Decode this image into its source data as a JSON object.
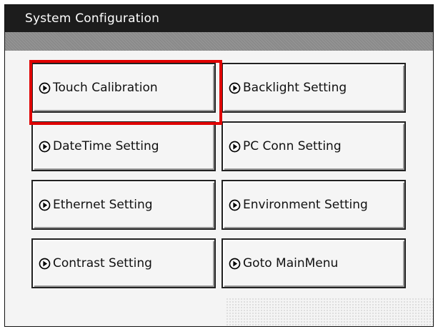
{
  "window": {
    "title": "System Configuration"
  },
  "menu": {
    "buttons": [
      {
        "label": "Touch Calibration",
        "icon": "circle-arrow-right-icon"
      },
      {
        "label": "Backlight Setting",
        "icon": "circle-arrow-right-icon"
      },
      {
        "label": "DateTime Setting",
        "icon": "circle-arrow-right-icon"
      },
      {
        "label": "PC Conn Setting",
        "icon": "circle-arrow-right-icon"
      },
      {
        "label": "Ethernet Setting",
        "icon": "circle-arrow-right-icon"
      },
      {
        "label": "Environment Setting",
        "icon": "circle-arrow-right-icon"
      },
      {
        "label": "Contrast Setting",
        "icon": "circle-arrow-right-icon"
      },
      {
        "label": "Goto MainMenu",
        "icon": "circle-arrow-right-icon"
      }
    ],
    "highlight_color": "#e00000"
  }
}
